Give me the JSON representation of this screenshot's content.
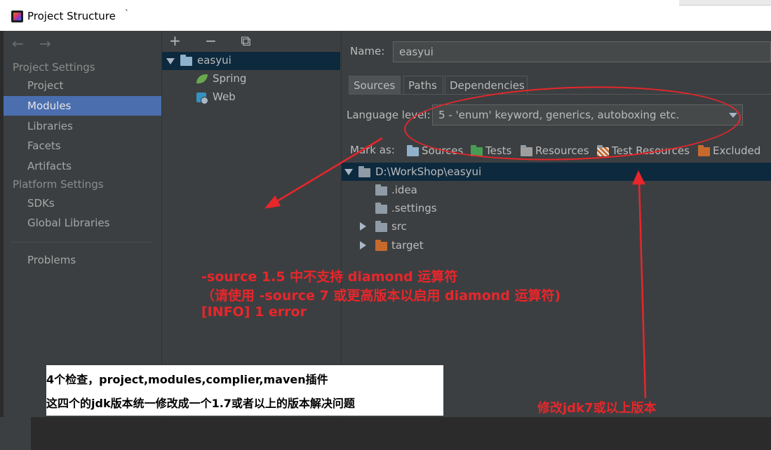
{
  "window": {
    "title": "Project Structure",
    "tick": "`"
  },
  "nav": {
    "arrows": "← →",
    "project_settings_header": "Project Settings",
    "project_items": [
      "Project",
      "Modules",
      "Libraries",
      "Facets",
      "Artifacts"
    ],
    "platform_settings_header": "Platform Settings",
    "platform_items": [
      "SDKs",
      "Global Libraries"
    ],
    "problems": "Problems",
    "selected": "Modules"
  },
  "tree": {
    "toolbar": "+ − ⧉",
    "root": "easyui",
    "children": [
      "Spring",
      "Web"
    ]
  },
  "module": {
    "name_label": "Name:",
    "name_value": "easyui",
    "tabs": [
      "Sources",
      "Paths",
      "Dependencies"
    ],
    "active_tab": "Sources",
    "language_level_label": "Language level:",
    "language_level_value": "5 - 'enum' keyword, generics, autoboxing etc.",
    "mark_as_label": "Mark as:",
    "mark_as": [
      "Sources",
      "Tests",
      "Resources",
      "Test Resources",
      "Excluded"
    ]
  },
  "content_tree": {
    "root": "D:\\WorkShop\\easyui",
    "items": [
      ".idea",
      ".settings",
      "src",
      "target"
    ]
  },
  "annotations": {
    "error_line1": "-source 1.5 中不支持 diamond 运算符",
    "error_line2": "（请使用 -source 7 或更高版本以启用 diamond 运算符)",
    "error_line3": "[INFO] 1 error",
    "note_line1": "4个检查，project,modules,complier,maven插件",
    "note_line2": "这四个的jdk版本统一修改成一个1.7或者以上的版本解决问题",
    "fix_hint": "修改jdk7或以上版本"
  },
  "colors": {
    "accent_selected": "#4b6eaf",
    "tree_selected": "#0d293e",
    "annotation_red": "#e8262b"
  }
}
